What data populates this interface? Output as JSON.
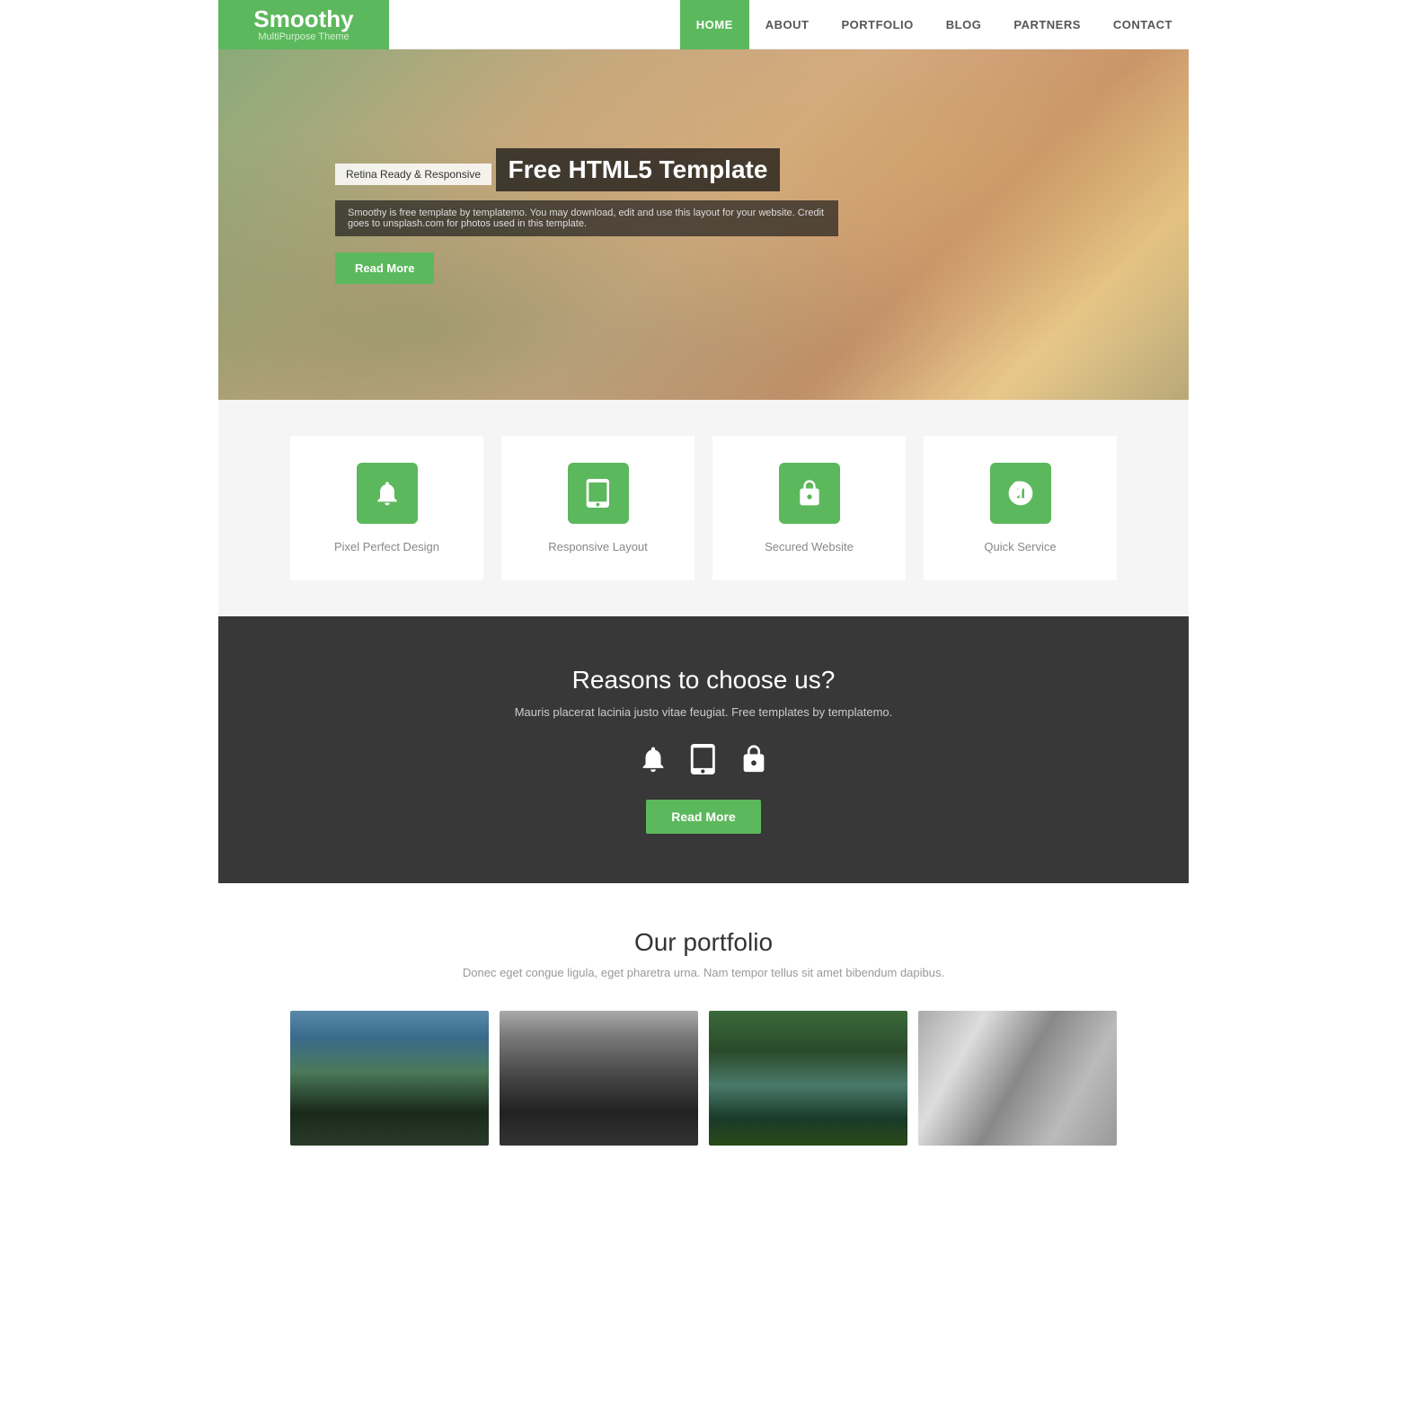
{
  "logo": {
    "title": "Smoothy",
    "subtitle": "MultiPurpose Theme"
  },
  "nav": {
    "items": [
      {
        "label": "HOME",
        "active": true
      },
      {
        "label": "ABOUT",
        "active": false
      },
      {
        "label": "PORTFOLIO",
        "active": false
      },
      {
        "label": "BLOG",
        "active": false
      },
      {
        "label": "PARTNERS",
        "active": false
      },
      {
        "label": "CONTACT",
        "active": false
      }
    ]
  },
  "hero": {
    "badge": "Retina Ready & Responsive",
    "title": "Free HTML5 Template",
    "description": "Smoothy is free template by templatemo. You may download, edit and use this layout for your website. Credit goes to unsplash.com for photos used in this template.",
    "button_label": "Read More"
  },
  "features": {
    "items": [
      {
        "label": "Pixel Perfect Design",
        "icon": "bell"
      },
      {
        "label": "Responsive Layout",
        "icon": "tablet"
      },
      {
        "label": "Secured Website",
        "icon": "lock"
      },
      {
        "label": "Quick Service",
        "icon": "rocket"
      }
    ]
  },
  "reasons": {
    "title": "Reasons to choose us?",
    "description": "Mauris placerat lacinia justo vitae feugiat. Free templates by templatemo.",
    "button_label": "Read More"
  },
  "portfolio": {
    "title": "Our portfolio",
    "description": "Donec eget congue ligula, eget pharetra urna. Nam tempor tellus sit amet bibendum dapibus.",
    "items": [
      {
        "alt": "Portfolio item 1"
      },
      {
        "alt": "Portfolio item 2"
      },
      {
        "alt": "Portfolio item 3"
      },
      {
        "alt": "Portfolio item 4"
      }
    ]
  }
}
